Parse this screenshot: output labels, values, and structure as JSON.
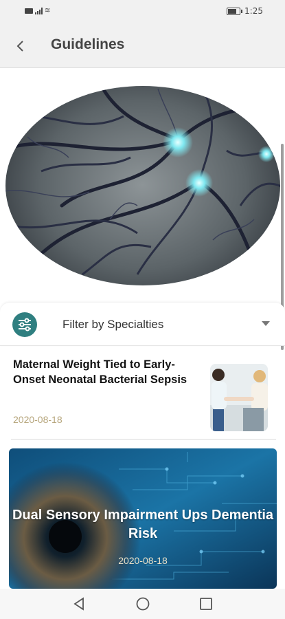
{
  "status_bar": {
    "time": "1:25"
  },
  "header": {
    "title": "Guidelines"
  },
  "filter": {
    "label": "Filter by Specialties"
  },
  "articles": [
    {
      "title": "Maternal Weight Tied to Early-Onset Neonatal Bacterial Sepsis",
      "date": "2020-08-18"
    }
  ],
  "featured": {
    "title": "Dual Sensory Impairment Ups Dementia Risk",
    "date": "2020-08-18"
  },
  "colors": {
    "accent": "#2f7f80",
    "date_text": "#b5a47a"
  }
}
